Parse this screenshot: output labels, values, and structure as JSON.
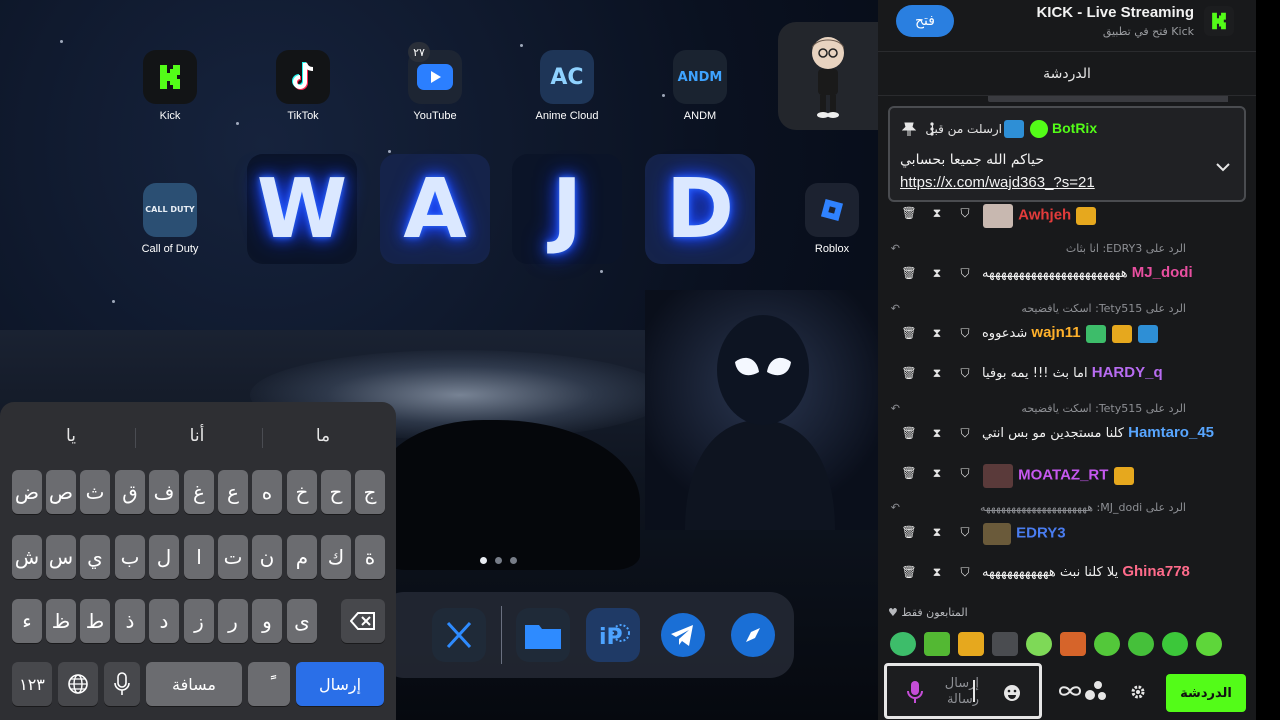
{
  "home": {
    "apps": [
      {
        "label": "Kick",
        "icon": "kick-icon"
      },
      {
        "label": "TikTok",
        "icon": "tiktok-icon"
      },
      {
        "label": "YouTube",
        "icon": "youtube-icon",
        "badge": "٢٧"
      },
      {
        "label": "Anime Cloud",
        "icon": "anime-cloud-icon",
        "glyph": "AC"
      },
      {
        "label": "ANDM",
        "icon": "andm-icon",
        "glyph": "ANDM"
      },
      {
        "label": "Call of Duty",
        "icon": "call-of-duty-icon",
        "glyph": "CALL DUTY"
      },
      {
        "label": "Roblox",
        "icon": "roblox-icon"
      }
    ],
    "neon_letters": [
      "W",
      "A",
      "J",
      "D"
    ],
    "page_dots": 3,
    "active_page": 1,
    "dock": [
      "x-icon",
      "files-icon",
      "ipapp-icon",
      "telegram-icon",
      "safari-icon"
    ]
  },
  "keyboard": {
    "suggestions": [
      "يا",
      "أنا",
      "ما"
    ],
    "row1": [
      "ض",
      "ص",
      "ث",
      "ق",
      "ف",
      "غ",
      "ع",
      "ه",
      "خ",
      "ح",
      "ج"
    ],
    "row2": [
      "ش",
      "س",
      "ي",
      "ب",
      "ل",
      "ا",
      "ت",
      "ن",
      "م",
      "ك",
      "ة"
    ],
    "row3": [
      "ء",
      "ظ",
      "ط",
      "ذ",
      "د",
      "ز",
      "ر",
      "و",
      "ى"
    ],
    "numbers_key": "١٢٣",
    "space_key": "مسافة",
    "diacritic_key": "ًً",
    "send_key": "إرسال"
  },
  "kick": {
    "open_button": "فتح",
    "title": "KICK - Live Streaming",
    "subtitle": "فتح في تطبيق Kick",
    "chat_header": "الدردشة",
    "pinned": {
      "bot": "BotRix",
      "sent_by": "ارسلت من قبل",
      "text": "حياكم الله جميعا بحسابي",
      "link": "https://x.com/wajd363_?s=21"
    },
    "messages": [
      {
        "user": "Awhjeh",
        "color": "#e23b3b",
        "text": ""
      },
      {
        "reply": "الرد على EDRY3: انا بثاث",
        "user": "MJ_dodi",
        "color": "#e84fa0",
        "text": "هههههههههههههههههههههههه"
      },
      {
        "reply": "الرد على Tety515: اسكت يافضيحه",
        "user": "wajn11",
        "color": "#ffb12b",
        "text": "شدعووه"
      },
      {
        "user": "HARDY_q",
        "color": "#b86cf2",
        "text": "اما بث !!! يمه بوفيا"
      },
      {
        "reply": "الرد على Tety515: اسكت يافضيحه",
        "user": "Hamtaro_45",
        "color": "#58a6ff",
        "text": "كلنا مستجدين مو بس انتي"
      },
      {
        "user": "MOATAZ_RT",
        "color": "#c658f0",
        "text": ""
      },
      {
        "reply": "الرد على MJ_dodi: هههههههههههههههههههههه",
        "user": "EDRY3",
        "color": "#4a7df0",
        "text": ""
      },
      {
        "user": "Ghina778",
        "color": "#ff6b8b",
        "text": "يلا كلنا نبث هههههههههههه"
      }
    ],
    "followers_only": "المتابعون فقط",
    "input_placeholder": "إرسال رسالة",
    "chat_button": "الدردشة"
  }
}
